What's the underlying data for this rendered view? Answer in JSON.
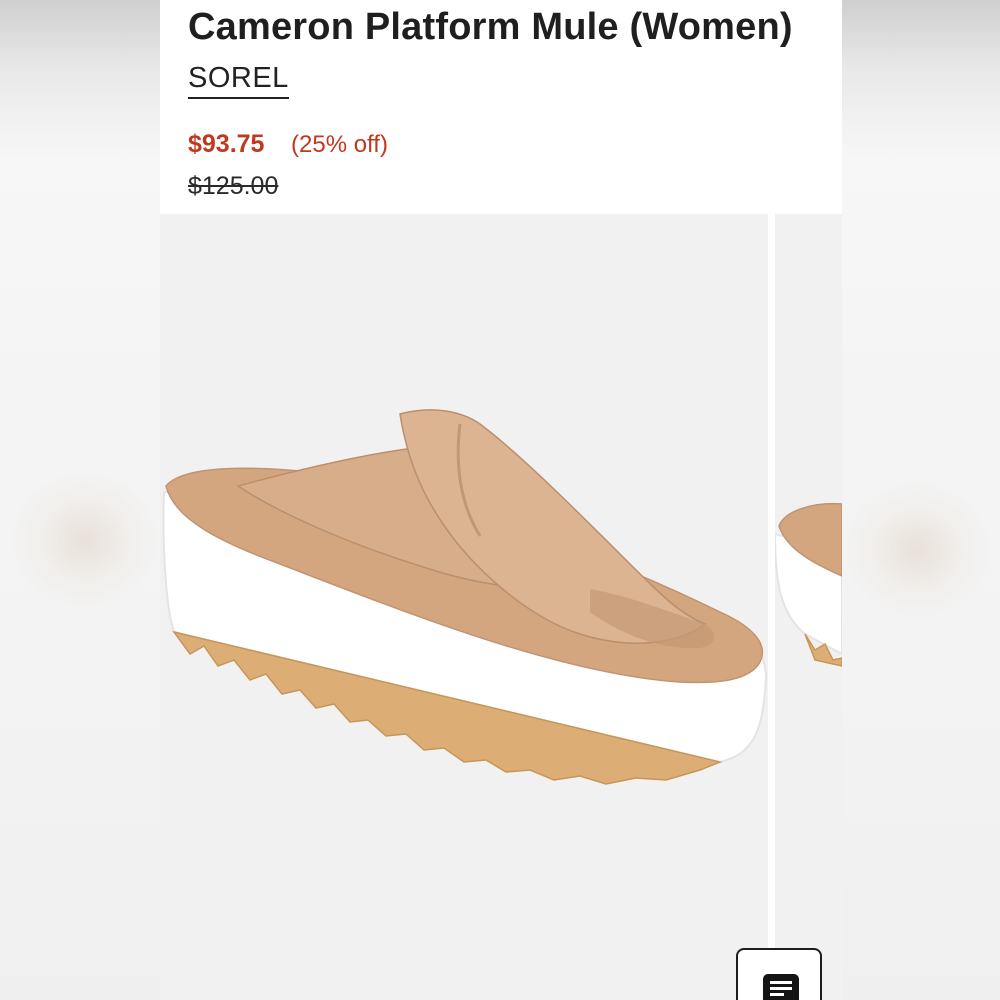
{
  "product": {
    "title": "Cameron Platform Mule (Women)",
    "brand": "SOREL"
  },
  "pricing": {
    "sale_price": "$93.75",
    "discount": "(25% off)",
    "original_price": "$125.00",
    "sale_color": "#c2381f"
  },
  "gallery": {
    "main_image_icon": "sandal-product-image",
    "next_image_icon": "sandal-product-image-peek"
  },
  "floating_button": {
    "icon": "document-icon"
  },
  "colors": {
    "leather": "#d6a986",
    "sole": "#ffffff",
    "outsole": "#d9a86c",
    "background": "#f1f1f1"
  }
}
